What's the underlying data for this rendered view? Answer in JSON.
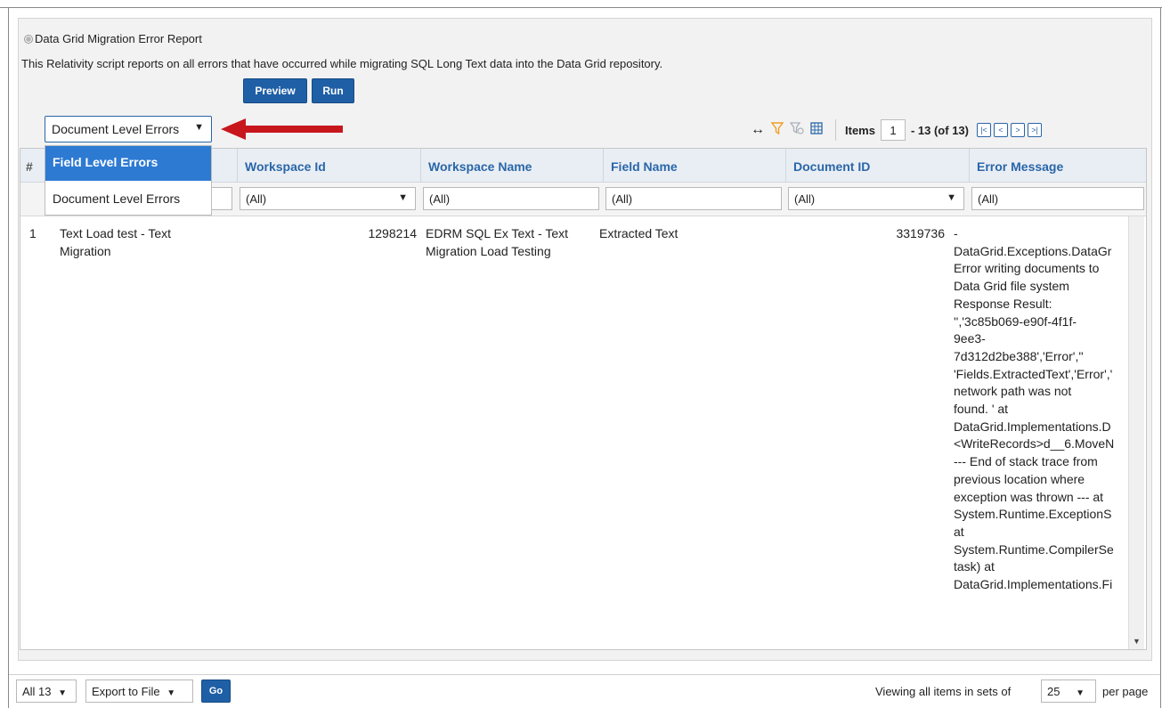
{
  "report": {
    "title": "Data Grid Migration Error Report",
    "description": "This Relativity script reports on all errors that have occurred while migrating SQL Long Text data into the Data Grid repository.",
    "preview_label": "Preview",
    "run_label": "Run"
  },
  "view_select": {
    "value": "Document Level Errors",
    "options": [
      "Field Level Errors",
      "Document Level Errors"
    ]
  },
  "toolbar": {
    "items_label": "Items",
    "page_value": "1",
    "range_text": "- 13 (of 13)"
  },
  "grid": {
    "row_number_header": "#",
    "columns": [
      "Workspace Id",
      "Workspace Name",
      "Field Name",
      "Document ID",
      "Error Message"
    ],
    "filters": [
      "(All)",
      "(All)",
      "(All)",
      "(All)",
      "(All)"
    ],
    "rows": [
      {
        "num": "1",
        "name_line1": "Text Load test - Text",
        "name_line2": "Migration",
        "workspace_id": "1298214",
        "workspace_name_line1": "EDRM SQL Ex Text - Text",
        "workspace_name_line2": "Migration Load Testing",
        "field_name": "Extracted Text",
        "document_id": "3319736",
        "error_message": "-\nDataGrid.Exceptions.DataGr\nError writing documents to\nData Grid file system\nResponse Result:\n'','3c85b069-e90f-4f1f-\n9ee3-\n7d312d2be388','Error',''\n'Fields.ExtractedText','Error','\nnetwork path was not\nfound. ' at\nDataGrid.Implementations.D\n<WriteRecords>d__6.MoveN\n--- End of stack trace from\nprevious location where\nexception was thrown --- at\nSystem.Runtime.ExceptionS\nat\nSystem.Runtime.CompilerSe\ntask) at\nDataGrid.Implementations.Fi"
      }
    ]
  },
  "footer": {
    "all_select": "All 13",
    "export_select": "Export to File",
    "go_label": "Go",
    "viewing_text": "Viewing all items in sets of",
    "per_page_value": "25",
    "per_page_text": "per page"
  },
  "colors": {
    "primary_blue": "#1f5fa5",
    "link_blue": "#2a66a8",
    "selected_item": "#2d7ad3",
    "arrow_red": "#c8161d",
    "filter_orange": "#f0a020"
  },
  "icons": [
    "radio-icon",
    "expand-columns-icon",
    "filter-icon",
    "clear-filter-icon",
    "grid-icon",
    "first-page-icon",
    "prev-page-icon",
    "next-page-icon",
    "last-page-icon",
    "red-arrow-annotation"
  ]
}
